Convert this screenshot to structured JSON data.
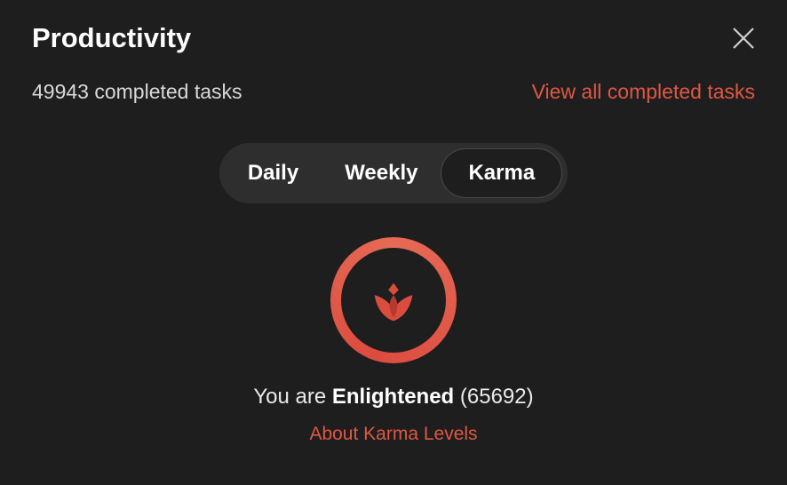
{
  "header": {
    "title": "Productivity"
  },
  "subheader": {
    "completed_count": "49943",
    "completed_label": "completed tasks",
    "view_all_label": "View all completed tasks"
  },
  "tabs": {
    "daily": "Daily",
    "weekly": "Weekly",
    "karma": "Karma"
  },
  "karma": {
    "prefix": "You are ",
    "level": "Enlightened",
    "points": "65692",
    "about_label": "About Karma Levels"
  }
}
